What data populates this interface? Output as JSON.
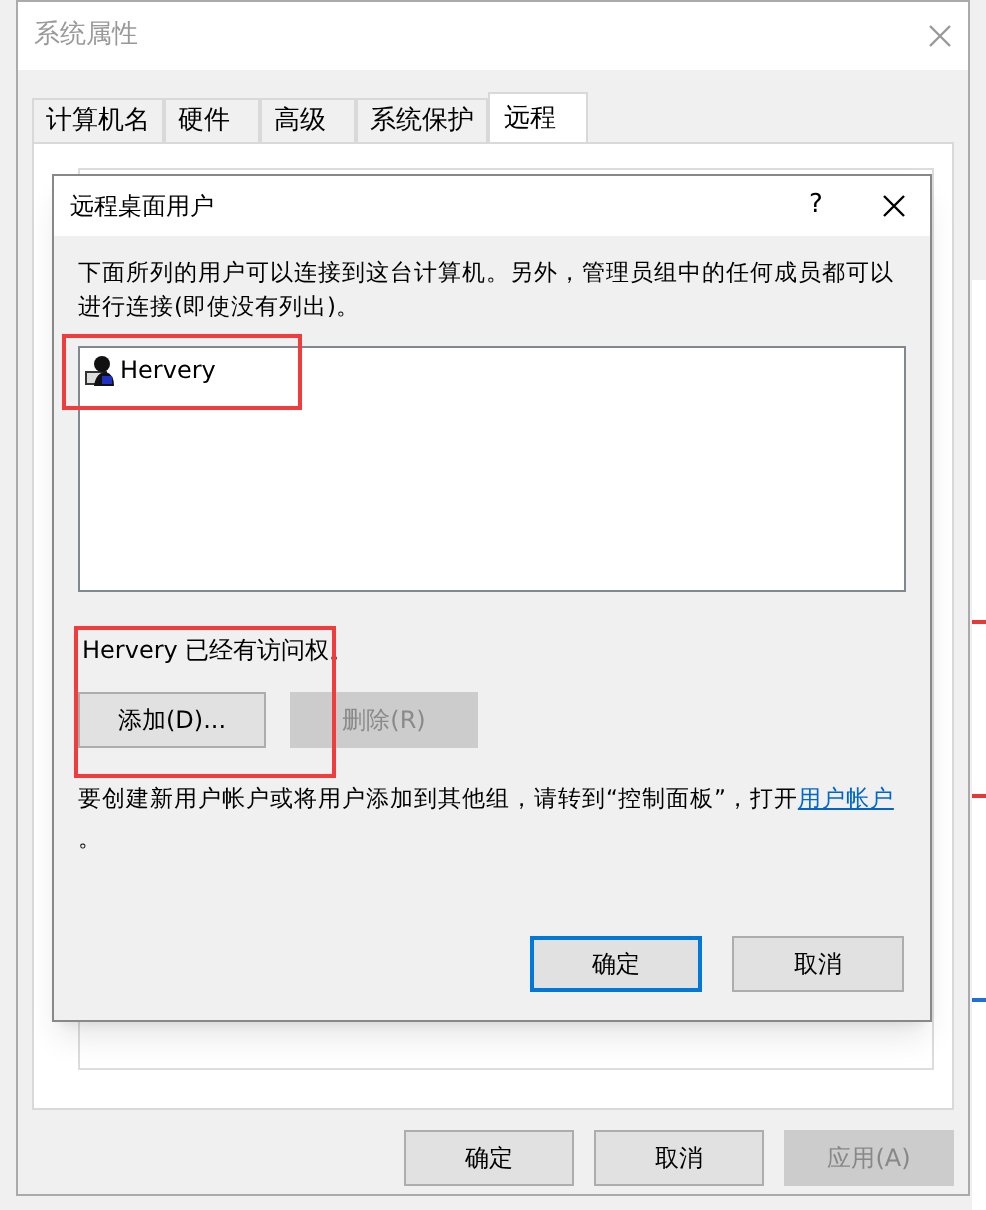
{
  "window": {
    "title": "系统属性"
  },
  "tabs": [
    {
      "label": "计算机名",
      "selected": false
    },
    {
      "label": "硬件",
      "selected": false
    },
    {
      "label": "高级",
      "selected": false
    },
    {
      "label": "系统保护",
      "selected": false
    },
    {
      "label": "远程",
      "selected": true
    }
  ],
  "buttons": [
    {
      "label": "确定",
      "disabled": false
    },
    {
      "label": "取消",
      "disabled": false
    },
    {
      "label": "应用(A)",
      "disabled": true
    }
  ],
  "dialog": {
    "title": "远程桌面用户",
    "help": "?",
    "intro": "下面所列的用户可以连接到这台计算机。另外，管理员组中的任何成员都可以进行连接(即使没有列出)。",
    "users": [
      {
        "name": "Hervery"
      }
    ],
    "status": "Hervery 已经有访问权。",
    "actions": [
      {
        "label": "添加(D)...",
        "disabled": false
      },
      {
        "label": "删除(R)",
        "disabled": true
      }
    ],
    "note": "要创建新用户帐户或将用户添加到其他组，请转到“控制面板”，打开",
    "note_link": "用户帐户",
    "note_end": "。",
    "buttons": [
      {
        "label": "确定",
        "default": true
      },
      {
        "label": "取消",
        "default": false
      }
    ]
  }
}
